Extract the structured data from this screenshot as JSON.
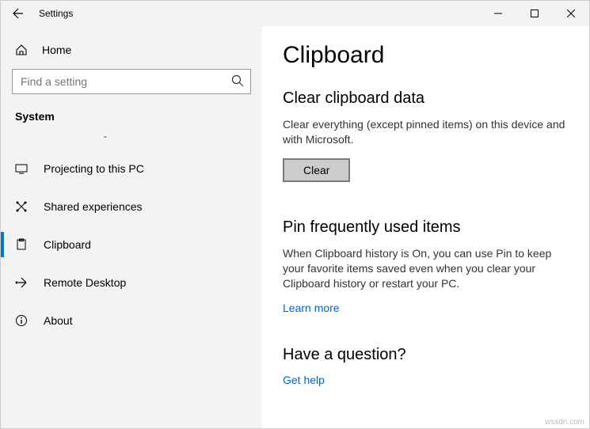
{
  "window": {
    "title": "Settings"
  },
  "sidebar": {
    "home": "Home",
    "search_placeholder": "Find a setting",
    "group": "System",
    "dash": "-",
    "items": [
      {
        "label": "Projecting to this PC"
      },
      {
        "label": "Shared experiences"
      },
      {
        "label": "Clipboard"
      },
      {
        "label": "Remote Desktop"
      },
      {
        "label": "About"
      }
    ]
  },
  "main": {
    "heading": "Clipboard",
    "section1_title": "Clear clipboard data",
    "section1_body": "Clear everything (except pinned items) on this device and with Microsoft.",
    "clear_label": "Clear",
    "section2_title": "Pin frequently used items",
    "section2_body": "When Clipboard history is On, you can use Pin to keep your favorite items saved even when you clear your Clipboard history or restart your PC.",
    "learn_more": "Learn more",
    "section3_title": "Have a question?",
    "get_help": "Get help"
  },
  "watermark": "wsxdn.com"
}
